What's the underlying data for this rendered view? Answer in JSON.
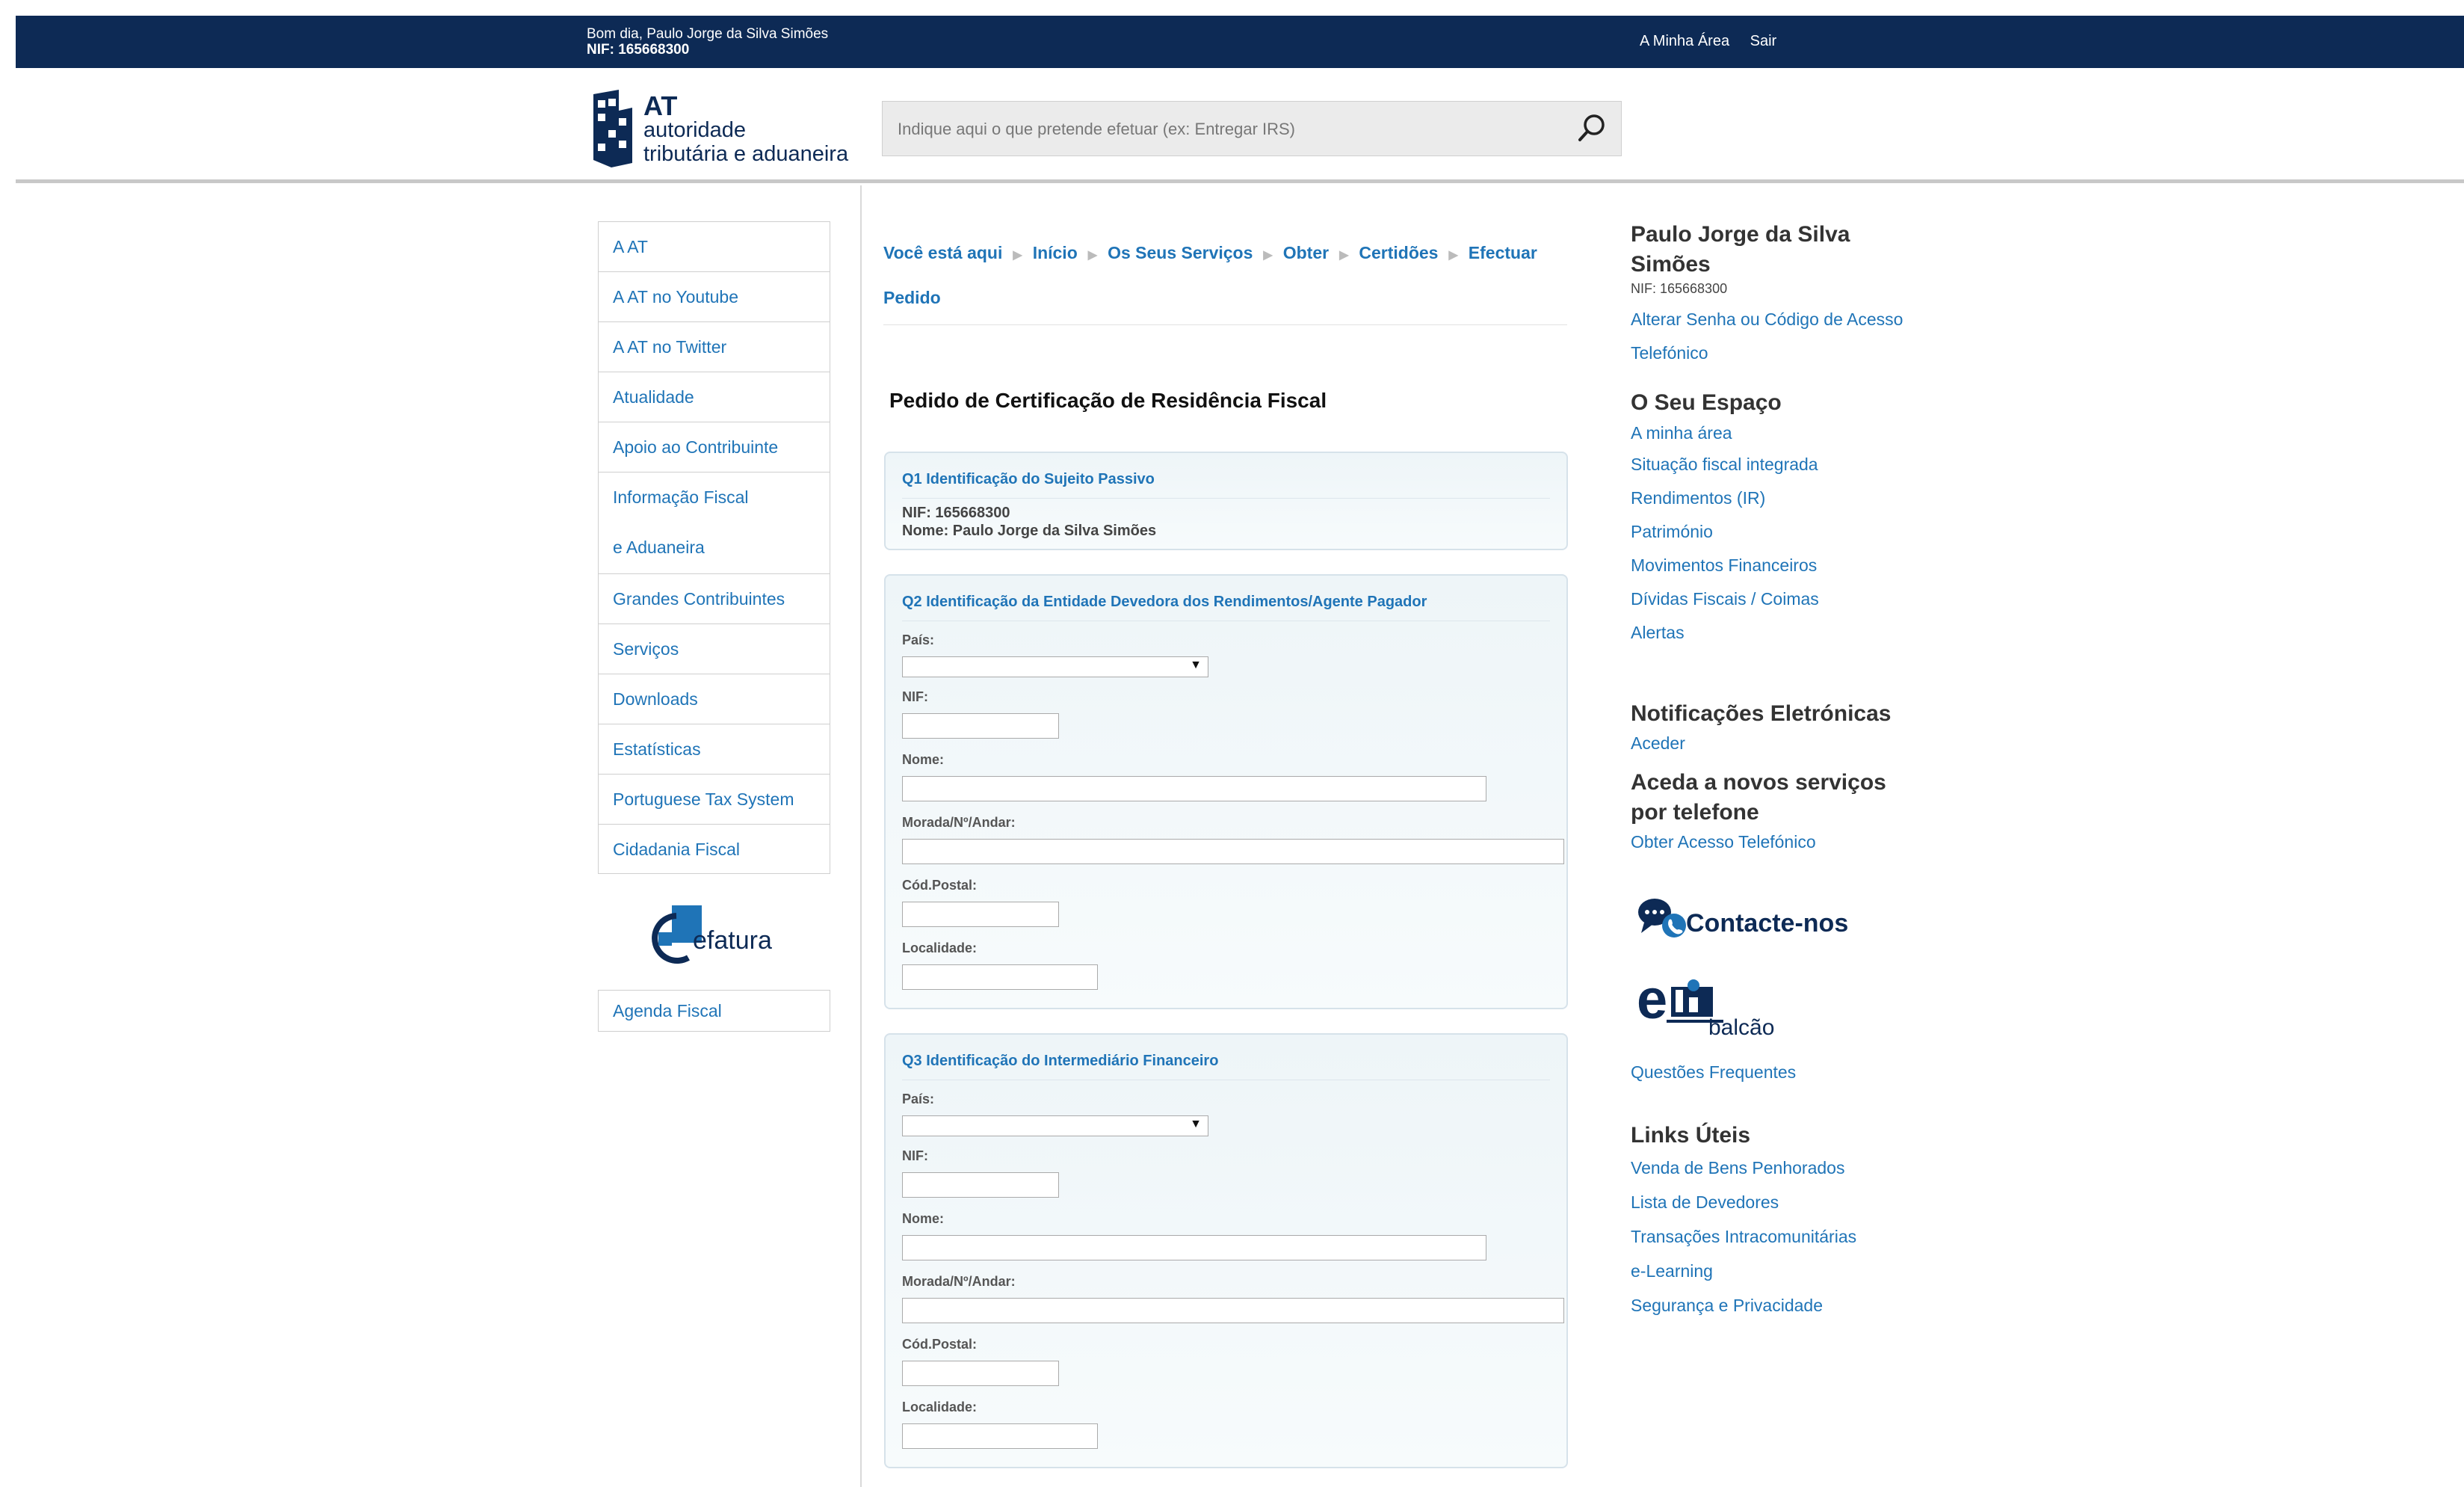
{
  "topbar": {
    "greeting": "Bom dia, Paulo Jorge da Silva Simões",
    "nif": "NIF: 165668300",
    "links": [
      "A Minha Área",
      "Sair"
    ]
  },
  "logo": {
    "line1": "AT",
    "line2": "autoridade",
    "line3": "tributária e aduaneira"
  },
  "search": {
    "placeholder": "Indique aqui o que pretende efetuar (ex: Entregar IRS)"
  },
  "leftnav": {
    "items": [
      "A AT",
      "A AT no Youtube",
      "A AT no Twitter",
      "Atualidade",
      "Apoio ao Contribuinte",
      "Informação Fiscal e Aduaneira",
      "Grandes Contribuintes",
      "Serviços",
      "Downloads",
      "Estatísticas",
      "Portuguese Tax System",
      "Cidadania Fiscal"
    ],
    "efatura": "efatura",
    "agenda": "Agenda Fiscal"
  },
  "breadcrumb": [
    "Você está aqui",
    "Início",
    "Os Seus Serviços",
    "Obter",
    "Certidões",
    "Efectuar Pedido"
  ],
  "page_title": "Pedido de Certificação de Residência Fiscal",
  "q1": {
    "title": "Q1 Identificação do Sujeito Passivo",
    "nif": "NIF: 165668300",
    "nome": "Nome: Paulo Jorge da Silva Simões"
  },
  "q2": {
    "title": "Q2 Identificação da Entidade Devedora dos Rendimentos/Agente Pagador",
    "pais": "País:",
    "nif": "NIF:",
    "nome": "Nome:",
    "morada": "Morada/Nº/Andar:",
    "codpostal": "Cód.Postal:",
    "localidade": "Localidade:"
  },
  "q3": {
    "title": "Q3 Identificação do Intermediário Financeiro",
    "pais": "País:",
    "nif": "NIF:",
    "nome": "Nome:",
    "morada": "Morada/Nº/Andar:",
    "codpostal": "Cód.Postal:",
    "localidade": "Localidade:"
  },
  "right": {
    "name_line1": "Paulo Jorge da Silva",
    "name_line2": "Simões",
    "nif": "NIF: 165668300",
    "change_pw_line1": "Alterar Senha ou Código de Acesso",
    "change_pw_line2": "Telefónico",
    "espaco_title": "O Seu Espaço",
    "espaco_links": [
      "A minha área",
      "Situação fiscal integrada",
      "Rendimentos (IR)",
      "Património",
      "Movimentos Financeiros",
      "Dívidas Fiscais / Coimas",
      "Alertas"
    ],
    "notif_title": "Notificações Eletrónicas",
    "notif_link": "Aceder",
    "phone_title_line1": "Aceda a novos serviços",
    "phone_title_line2": "por telefone",
    "phone_link": "Obter Acesso Telefónico",
    "contact": "Contacte-nos",
    "balcao": "balcão",
    "faq": "Questões Frequentes",
    "links_title": "Links Úteis",
    "links": [
      "Venda de Bens Penhorados",
      "Lista de Devedores",
      "Transações Intracomunitárias",
      "e-Learning",
      "Segurança e Privacidade"
    ]
  },
  "colors": {
    "topbar": "#0d2a55",
    "link": "#1f74b7"
  }
}
